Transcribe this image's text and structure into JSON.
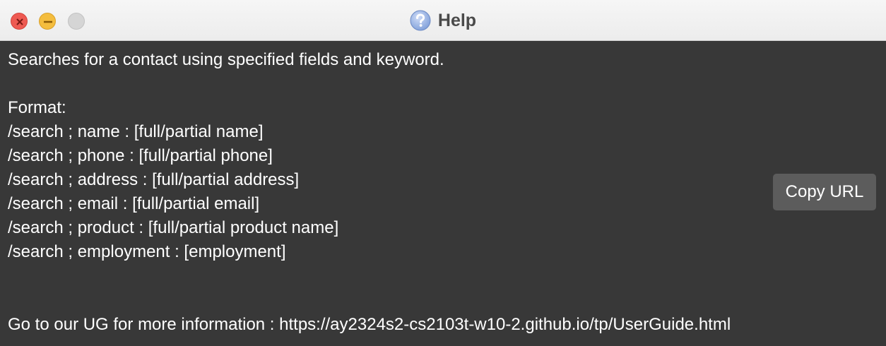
{
  "window": {
    "title": "Help",
    "title_icon": "question-circle-icon"
  },
  "help": {
    "description": "Searches for a contact using specified fields and keyword.",
    "format_label": "Format:",
    "format_lines": [
      "/search ; name : [full/partial name]",
      "/search ; phone : [full/partial phone]",
      "/search ; address : [full/partial address]",
      "/search ; email : [full/partial email]",
      "/search ; product : [full/partial product name]",
      "/search ; employment : [employment]"
    ],
    "footer": "Go to our UG for more information : https://ay2324s2-cs2103t-w10-2.github.io/tp/UserGuide.html"
  },
  "buttons": {
    "copy_url": "Copy URL"
  },
  "colors": {
    "background": "#383838",
    "titlebar": "#ececec",
    "button": "#5c5c5c",
    "close": "#ee5a52",
    "minimize": "#f4bd3e",
    "maximize_disabled": "#d5d5d5"
  }
}
